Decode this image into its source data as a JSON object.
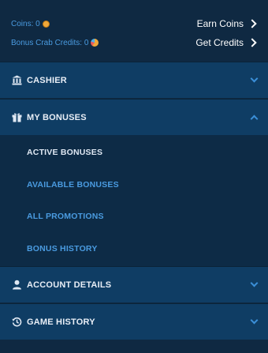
{
  "wallet": {
    "coins_label": "Coins: 0",
    "bonus_label": "Bonus Crab Credits: 0",
    "earn_label": "Earn Coins",
    "get_label": "Get Credits"
  },
  "sections": {
    "cashier": "CASHIER",
    "my_bonuses": "MY BONUSES",
    "account_details": "ACCOUNT DETAILS",
    "game_history": "GAME HISTORY"
  },
  "bonus_menu": [
    {
      "label": "ACTIVE BONUSES",
      "active": true
    },
    {
      "label": "AVAILABLE BONUSES",
      "active": false
    },
    {
      "label": "ALL PROMOTIONS",
      "active": false
    },
    {
      "label": "BONUS HISTORY",
      "active": false
    }
  ],
  "colors": {
    "background": "#0f2942",
    "section": "#0f3d64",
    "accent": "#4a9be0",
    "active_item": "#dfe8f3"
  },
  "icons": {
    "coin": "coin-icon",
    "credits": "crab-credit-icon",
    "cashier": "bank-icon",
    "bonuses": "gift-icon",
    "account": "user-icon",
    "history": "history-icon"
  }
}
